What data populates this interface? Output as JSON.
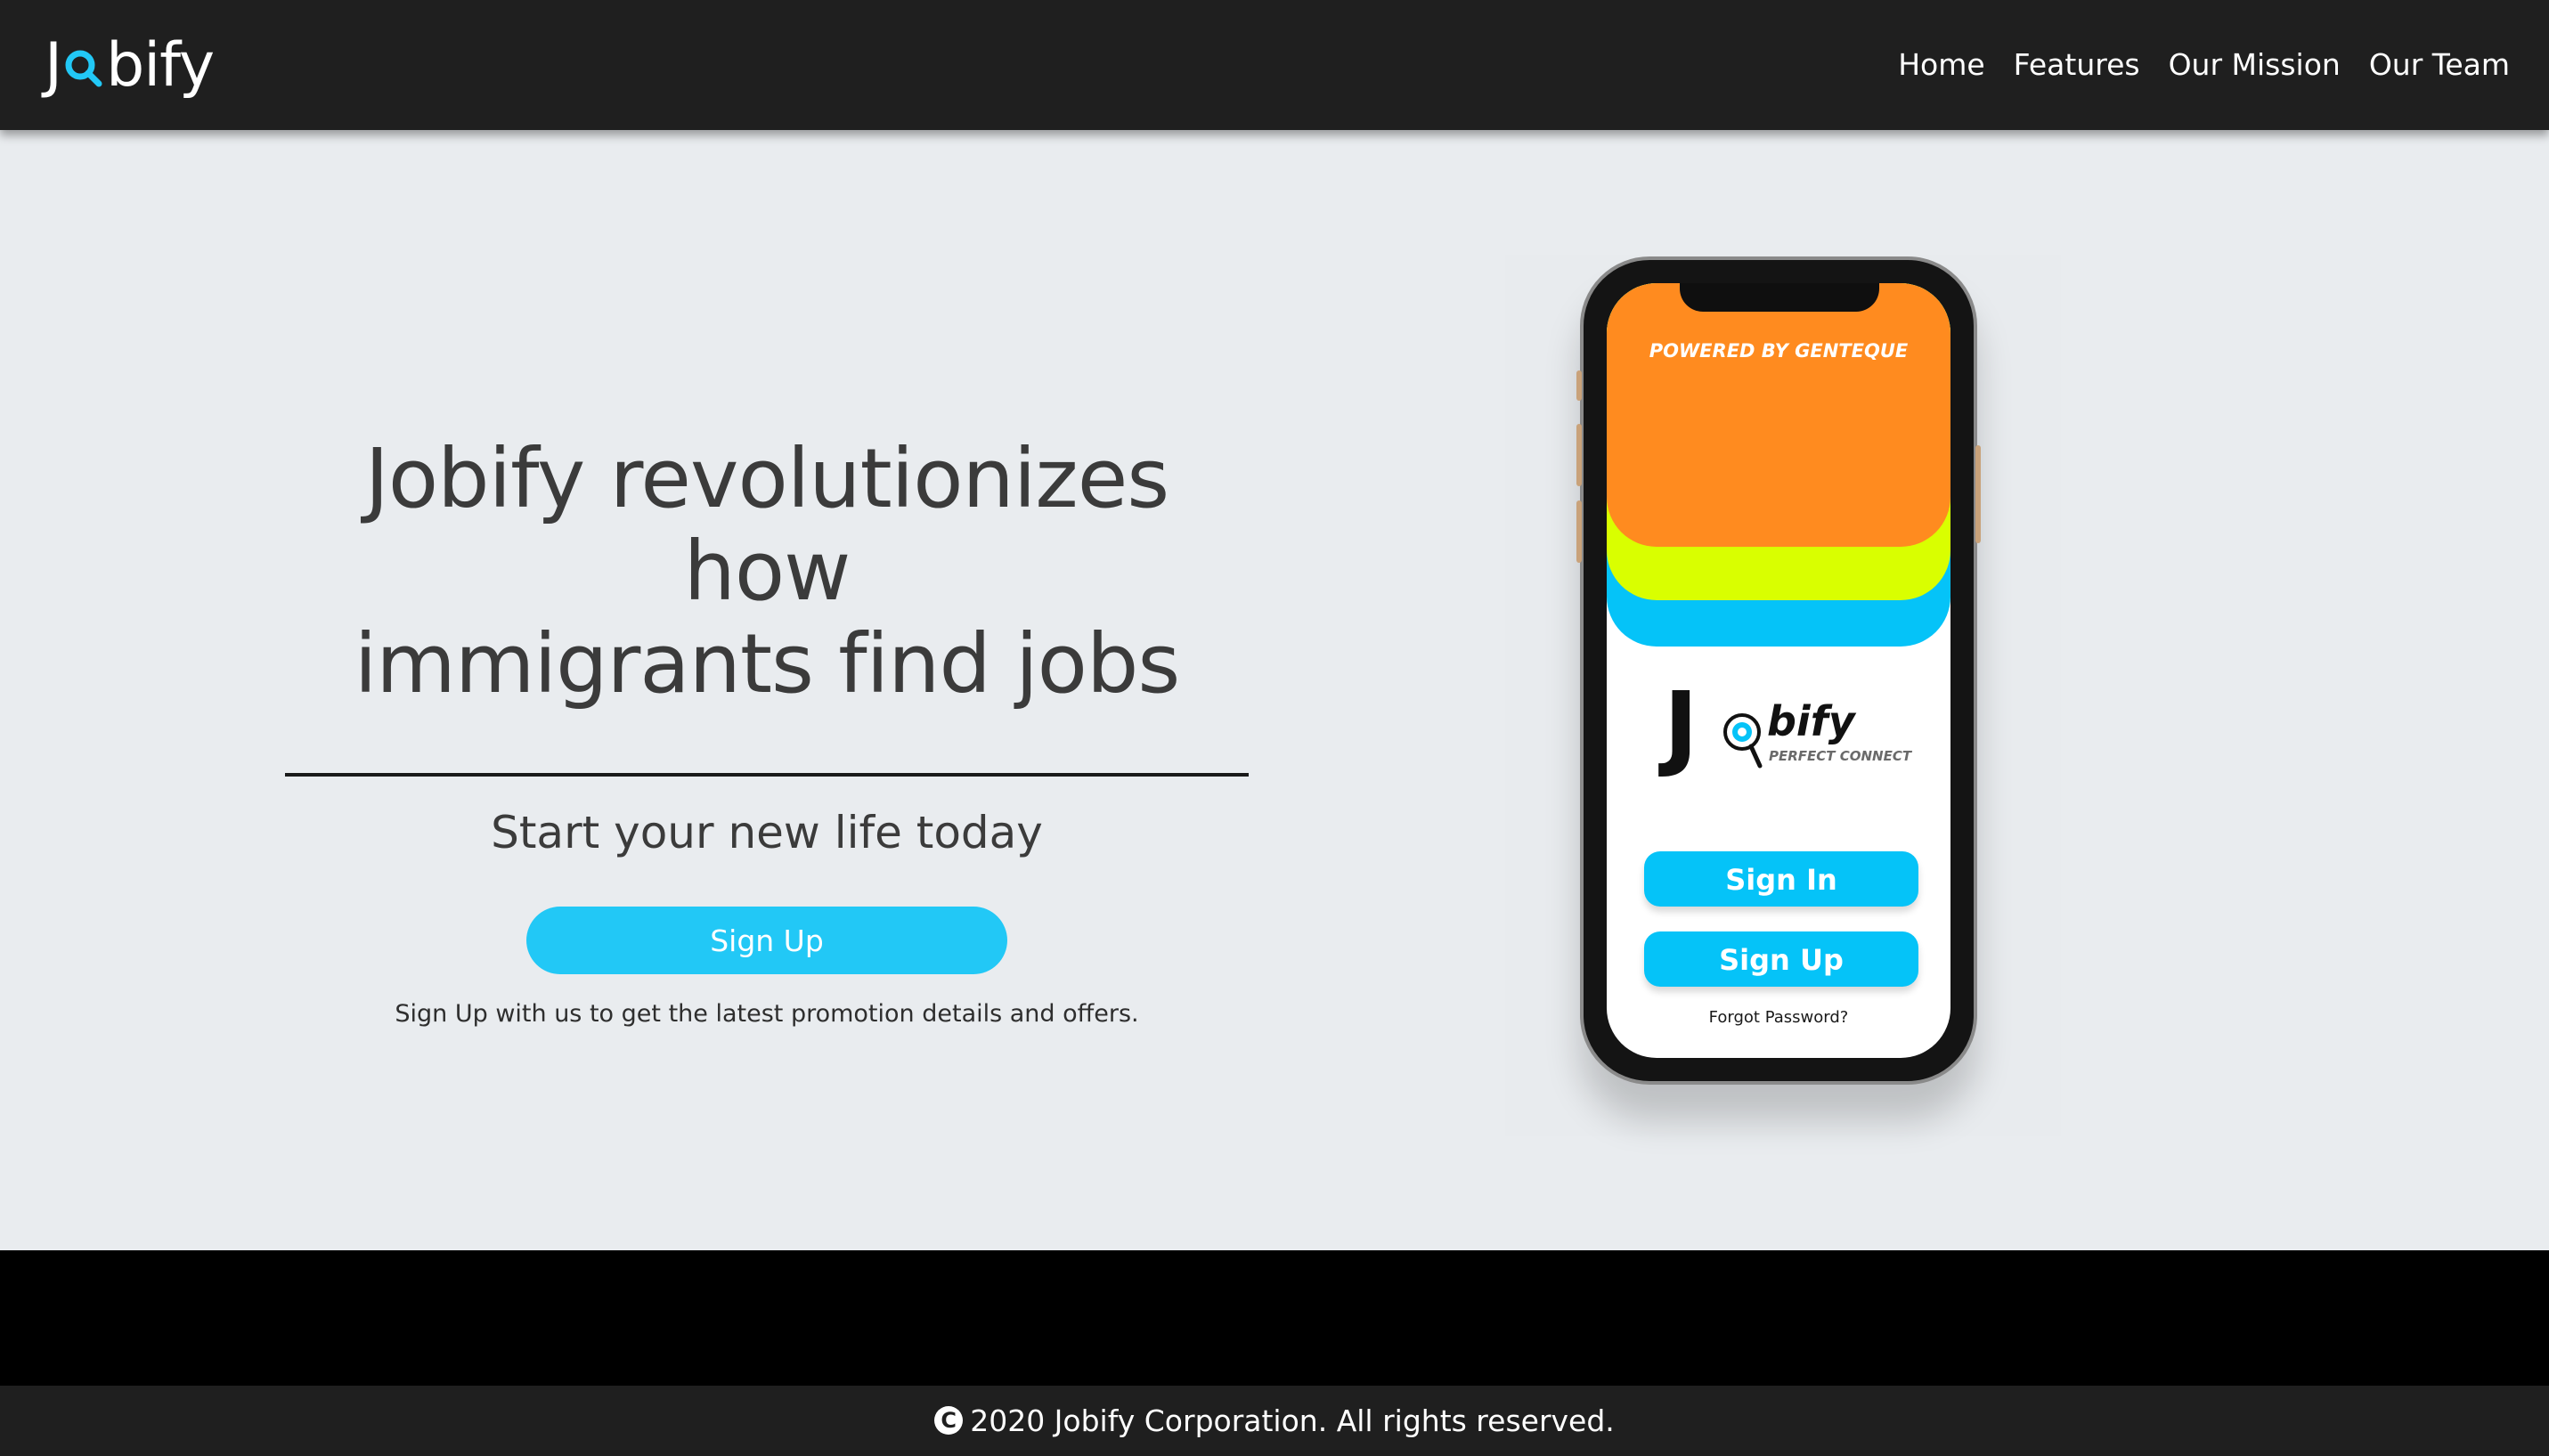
{
  "navbar": {
    "brand": {
      "prefix": "J",
      "suffix": "bify",
      "icon": "magnifier-icon",
      "accent": "#22c8f6"
    },
    "links": [
      {
        "label": "Home"
      },
      {
        "label": "Features"
      },
      {
        "label": "Our Mission"
      },
      {
        "label": "Our Team"
      }
    ]
  },
  "hero": {
    "headline_line1": "Jobify revolutionizes how",
    "headline_line2": "immigrants find jobs",
    "subhead": "Start your new life today",
    "cta_label": "Sign Up",
    "promo_text": "Sign Up with us to get the latest promotion details and offers."
  },
  "phone": {
    "powered_by": "POWERED BY GENTEQUE",
    "logo_j": "J",
    "logo_bify": "bify",
    "logo_tagline": "PERFECT CONNECT",
    "sign_in_label": "Sign In",
    "sign_up_label": "Sign Up",
    "forgot_label": "Forgot Password?",
    "colors": {
      "orange": "#ff8b1f",
      "lime": "#d9ff00",
      "blue": "#05c3f8"
    }
  },
  "footer": {
    "copyright_icon": "copyright-icon",
    "copyright_symbol": "C",
    "text": "2020 Jobify Corporation. All rights reserved."
  }
}
